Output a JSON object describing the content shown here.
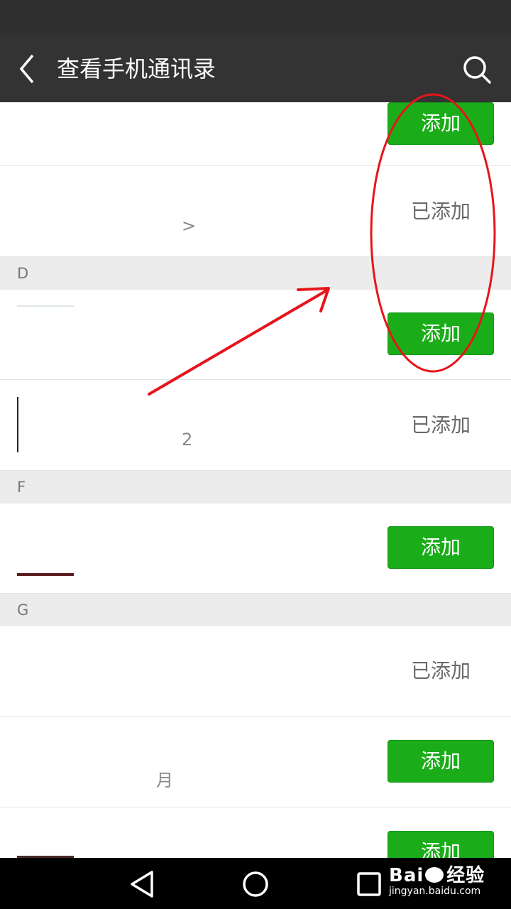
{
  "topbar": {
    "title": "查看手机通讯录",
    "back_icon": "back-arrow-icon",
    "search_icon": "search-icon"
  },
  "contacts": [
    {
      "status": "添加"
    },
    {
      "status": "已添加",
      "name_fragment": ">"
    },
    {
      "section": "D"
    },
    {
      "status": "添加"
    },
    {
      "status": "已添加",
      "name_fragment": "2"
    },
    {
      "section": "F"
    },
    {
      "status": "添加"
    },
    {
      "section": "G"
    },
    {
      "status": "已添加"
    },
    {
      "status": "添加",
      "name_fragment": "月"
    },
    {
      "status": "添加"
    }
  ],
  "navbar": {
    "back_icon": "triangle-back-icon",
    "home_icon": "circle-home-icon",
    "recents_icon": "square-recents-icon"
  },
  "watermark": {
    "brand": "Bai",
    "brand_cn": "经验",
    "url": "jingyan.baidu.com"
  },
  "colors": {
    "add_button": "#1aad19",
    "topbar": "#333333",
    "annotation": "#e8141b"
  }
}
